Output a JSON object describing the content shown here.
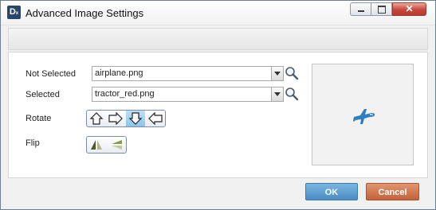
{
  "window": {
    "title": "Advanced Image Settings",
    "icon": "app-logo-icon",
    "app_icon_letter": "D",
    "app_icon_sub": "x",
    "controls": {
      "close_glyph": "✕"
    }
  },
  "form": {
    "not_selected": {
      "label": "Not Selected",
      "value": "airplane.png"
    },
    "selected": {
      "label": "Selected",
      "value": "tractor_red.png"
    },
    "rotate": {
      "label": "Rotate",
      "options": [
        "rotate-up-icon",
        "rotate-right-icon",
        "rotate-down-icon",
        "rotate-left-icon"
      ],
      "active_index": 2
    },
    "flip": {
      "label": "Flip",
      "options": [
        "flip-horizontal-icon",
        "flip-vertical-icon"
      ]
    }
  },
  "preview": {
    "icon": "airplane-icon"
  },
  "buttons": {
    "ok": "OK",
    "cancel": "Cancel"
  },
  "colors": {
    "ok": "#4a8dc4",
    "cancel": "#c2623c",
    "active_toggle": "#89c6ec",
    "airplane": "#2e7fc1"
  }
}
